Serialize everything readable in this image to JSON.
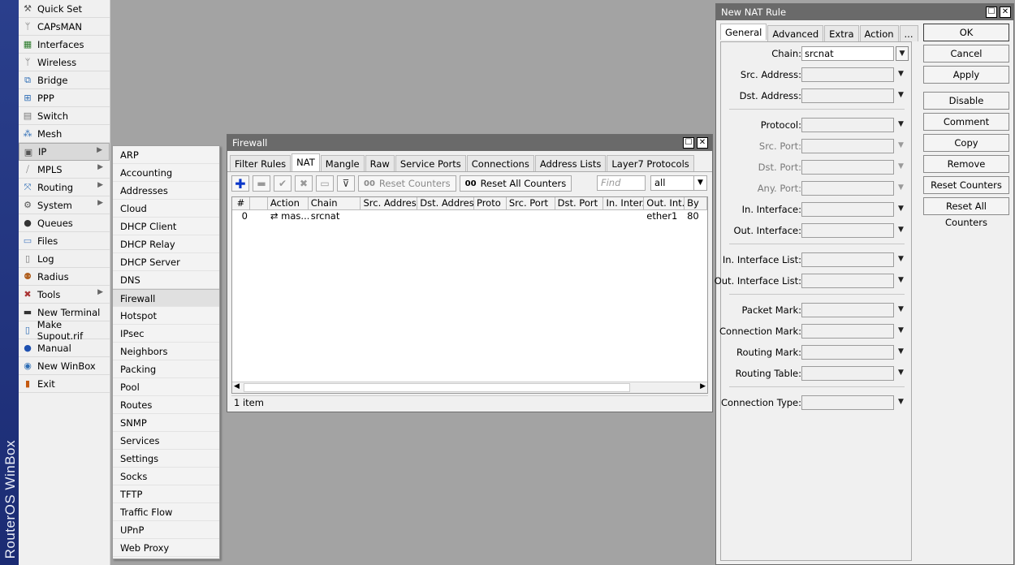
{
  "brand": "RouterOS WinBox",
  "main_menu": [
    {
      "label": "Quick Set",
      "icon": "quick-set-icon",
      "glyph": "⚒",
      "color": "#555"
    },
    {
      "label": "CAPsMAN",
      "icon": "capsman-icon",
      "glyph": "ᛘ",
      "color": "#666"
    },
    {
      "label": "Interfaces",
      "icon": "interfaces-icon",
      "glyph": "▦",
      "color": "#2a7a2a"
    },
    {
      "label": "Wireless",
      "icon": "wireless-icon",
      "glyph": "ᛘ",
      "color": "#666"
    },
    {
      "label": "Bridge",
      "icon": "bridge-icon",
      "glyph": "⧉",
      "color": "#2d6db5"
    },
    {
      "label": "PPP",
      "icon": "ppp-icon",
      "glyph": "⊞",
      "color": "#2d6db5"
    },
    {
      "label": "Switch",
      "icon": "switch-icon",
      "glyph": "▤",
      "color": "#777"
    },
    {
      "label": "Mesh",
      "icon": "mesh-icon",
      "glyph": "⁂",
      "color": "#2d6db5"
    },
    {
      "label": "IP",
      "icon": "ip-icon",
      "glyph": "▣",
      "color": "#555",
      "arrow": true
    },
    {
      "label": "MPLS",
      "icon": "mpls-icon",
      "glyph": "⧸",
      "color": "#777",
      "arrow": true
    },
    {
      "label": "Routing",
      "icon": "routing-icon",
      "glyph": "⤧",
      "color": "#2d6db5",
      "arrow": true
    },
    {
      "label": "System",
      "icon": "system-icon",
      "glyph": "⚙",
      "color": "#555",
      "arrow": true
    },
    {
      "label": "Queues",
      "icon": "queues-icon",
      "glyph": "●",
      "color": "#333"
    },
    {
      "label": "Files",
      "icon": "files-icon",
      "glyph": "▭",
      "color": "#4a7dc0"
    },
    {
      "label": "Log",
      "icon": "log-icon",
      "glyph": "▯",
      "color": "#777"
    },
    {
      "label": "Radius",
      "icon": "radius-icon",
      "glyph": "⚉",
      "color": "#b06020"
    },
    {
      "label": "Tools",
      "icon": "tools-icon",
      "glyph": "✖",
      "color": "#a33",
      "arrow": true
    },
    {
      "label": "New Terminal",
      "icon": "terminal-icon",
      "glyph": "▬",
      "color": "#333"
    },
    {
      "label": "Make Supout.rif",
      "icon": "supout-icon",
      "glyph": "▯",
      "color": "#2d6db5"
    },
    {
      "label": "Manual",
      "icon": "manual-icon",
      "glyph": "●",
      "color": "#1e50b0"
    },
    {
      "label": "New WinBox",
      "icon": "winbox-icon",
      "glyph": "◉",
      "color": "#2d6db5"
    },
    {
      "label": "Exit",
      "icon": "exit-icon",
      "glyph": "▮",
      "color": "#c55a11"
    }
  ],
  "sub_menu": [
    "ARP",
    "Accounting",
    "Addresses",
    "Cloud",
    "DHCP Client",
    "DHCP Relay",
    "DHCP Server",
    "DNS",
    "Firewall",
    "Hotspot",
    "IPsec",
    "Neighbors",
    "Packing",
    "Pool",
    "Routes",
    "SNMP",
    "Services",
    "Settings",
    "Socks",
    "TFTP",
    "Traffic Flow",
    "UPnP",
    "Web Proxy"
  ],
  "firewall": {
    "title": "Firewall",
    "tabs": [
      "Filter Rules",
      "NAT",
      "Mangle",
      "Raw",
      "Service Ports",
      "Connections",
      "Address Lists",
      "Layer7 Protocols"
    ],
    "toolbar": {
      "reset_counters": "Reset Counters",
      "reset_all_counters": "Reset All Counters",
      "counter_prefix": "00",
      "find_placeholder": "Find",
      "filter_value": "all"
    },
    "columns": [
      "#",
      "",
      "Action",
      "Chain",
      "Src. Address",
      "Dst. Address",
      "Proto",
      "Src. Port",
      "Dst. Port",
      "In. Inter...",
      "Out. Int...",
      "By"
    ],
    "rows": [
      [
        "0",
        "",
        "⇄ mas...",
        "srcnat",
        "",
        "",
        "",
        "",
        "",
        "",
        "ether1",
        "80"
      ]
    ],
    "status": "1 item"
  },
  "nat_rule": {
    "title": "New NAT Rule",
    "tabs": [
      "General",
      "Advanced",
      "Extra",
      "Action",
      "..."
    ],
    "fields": {
      "chain": {
        "label": "Chain:",
        "value": "srcnat"
      },
      "src_address": {
        "label": "Src. Address:",
        "value": ""
      },
      "dst_address": {
        "label": "Dst. Address:",
        "value": ""
      },
      "protocol": {
        "label": "Protocol:",
        "value": ""
      },
      "src_port": {
        "label": "Src. Port:",
        "value": ""
      },
      "dst_port": {
        "label": "Dst. Port:",
        "value": ""
      },
      "any_port": {
        "label": "Any. Port:",
        "value": ""
      },
      "in_interface": {
        "label": "In. Interface:",
        "value": ""
      },
      "out_interface": {
        "label": "Out. Interface:",
        "value": ""
      },
      "in_interface_list": {
        "label": "In. Interface List:",
        "value": ""
      },
      "out_interface_list": {
        "label": "Out. Interface List:",
        "value": ""
      },
      "packet_mark": {
        "label": "Packet Mark:",
        "value": ""
      },
      "connection_mark": {
        "label": "Connection Mark:",
        "value": ""
      },
      "routing_mark": {
        "label": "Routing Mark:",
        "value": ""
      },
      "routing_table": {
        "label": "Routing Table:",
        "value": ""
      },
      "connection_type": {
        "label": "Connection Type:",
        "value": ""
      }
    },
    "buttons": {
      "ok": "OK",
      "cancel": "Cancel",
      "apply": "Apply",
      "disable": "Disable",
      "comment": "Comment",
      "copy": "Copy",
      "remove": "Remove",
      "reset_counters": "Reset Counters",
      "reset_all_counters": "Reset All Counters"
    }
  }
}
